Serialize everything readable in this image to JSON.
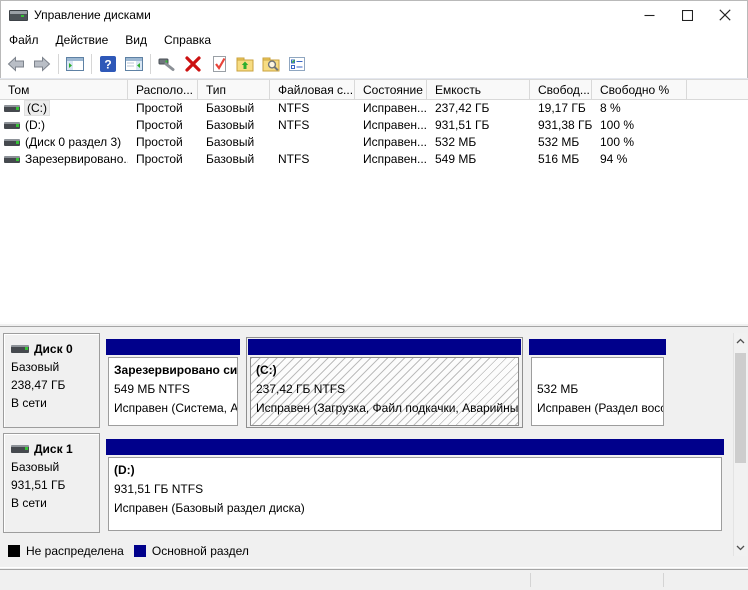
{
  "window": {
    "title": "Управление дисками"
  },
  "menu": {
    "items": [
      "Файл",
      "Действие",
      "Вид",
      "Справка"
    ]
  },
  "toolbar": {
    "icons": [
      "back",
      "forward",
      "show-console-tree",
      "help",
      "show-action-pane",
      "rescan-disks",
      "delete-volume",
      "mark-partition-active",
      "open",
      "explore",
      "properties"
    ]
  },
  "volume_list": {
    "columns": [
      "Том",
      "Располо...",
      "Тип",
      "Файловая с...",
      "Состояние",
      "Емкость",
      "Свобод...",
      "Свободно %"
    ],
    "rows": [
      {
        "name": "(C:)",
        "layout": "Простой",
        "type": "Базовый",
        "fs": "NTFS",
        "status": "Исправен...",
        "capacity": "237,42 ГБ",
        "free": "19,17 ГБ",
        "free_pct": "8 %"
      },
      {
        "name": "(D:)",
        "layout": "Простой",
        "type": "Базовый",
        "fs": "NTFS",
        "status": "Исправен...",
        "capacity": "931,51 ГБ",
        "free": "931,38 ГБ",
        "free_pct": "100 %"
      },
      {
        "name": "(Диск 0 раздел 3)",
        "layout": "Простой",
        "type": "Базовый",
        "fs": "",
        "status": "Исправен...",
        "capacity": "532 МБ",
        "free": "532 МБ",
        "free_pct": "100 %"
      },
      {
        "name": "Зарезервировано...",
        "layout": "Простой",
        "type": "Базовый",
        "fs": "NTFS",
        "status": "Исправен...",
        "capacity": "549 МБ",
        "free": "516 МБ",
        "free_pct": "94 %"
      }
    ]
  },
  "disks": [
    {
      "label": "Диск 0",
      "type": "Базовый",
      "size": "238,47 ГБ",
      "status": "В сети",
      "partitions": [
        {
          "name": "Зарезервировано сис",
          "size_fs": "549 МБ NTFS",
          "status": "Исправен (Система, Ак"
        },
        {
          "name": "(C:)",
          "size_fs": "237,42 ГБ NTFS",
          "status": "Исправен (Загрузка, Файл подкачки, Аварийны"
        },
        {
          "name": "",
          "size_fs": "532 МБ",
          "status": "Исправен (Раздел восс"
        }
      ]
    },
    {
      "label": "Диск 1",
      "type": "Базовый",
      "size": "931,51 ГБ",
      "status": "В сети",
      "partitions": [
        {
          "name": "(D:)",
          "size_fs": "931,51 ГБ NTFS",
          "status": "Исправен (Базовый раздел диска)"
        }
      ]
    }
  ],
  "legend": {
    "items": [
      {
        "label": "Не распределена",
        "color": "#000000"
      },
      {
        "label": "Основной раздел",
        "color": "#00008b"
      }
    ]
  },
  "colors": {
    "partition_bar": "#00008b",
    "selection_hatch": "#bdbdbd",
    "pane_background": "#f0f0f0"
  }
}
